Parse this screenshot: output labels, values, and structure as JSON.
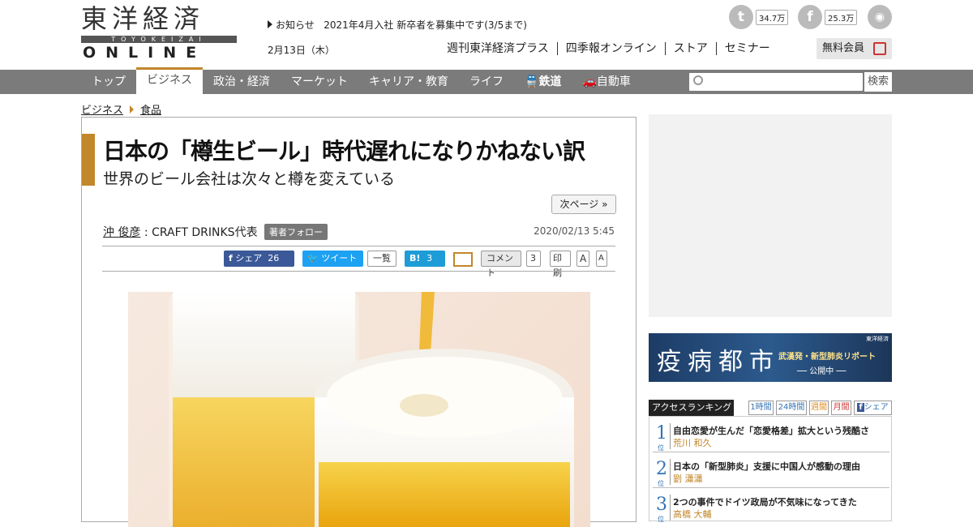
{
  "logo": {
    "kanji": "東洋経済",
    "latin": "TOYOKEIZAI",
    "online": "ONLINE"
  },
  "header": {
    "notice_label": "お知らせ",
    "notice_text": "2021年4月入社 新卒者を募集中です(3/5まで)",
    "date": "2月13日（木）",
    "links": [
      "週刊東洋経済プラス",
      "四季報オンライン",
      "ストア",
      "セミナー"
    ],
    "member_button": "無料会員",
    "twitter_count": "34.7万",
    "facebook_count": "25.3万"
  },
  "nav": {
    "items": [
      "トップ",
      "ビジネス",
      "政治・経済",
      "マーケット",
      "キャリア・教育",
      "ライフ",
      "鉄道",
      "自動車"
    ],
    "active_index": 1,
    "search_placeholder": "",
    "search_button": "検索"
  },
  "breadcrumb": [
    "ビジネス",
    "食品"
  ],
  "article": {
    "title": "日本の「樽生ビール」時代遅れになりかねない訳",
    "subtitle": "世界のビール会社は次々と樽を変えている",
    "next_page": "次ページ »",
    "author_name": "沖 俊彦",
    "author_role": " : CRAFT DRINKS代表",
    "follow_button": "著者フォロー",
    "pubdate": "2020/02/13 5:45"
  },
  "share": {
    "facebook_label": "シェア",
    "facebook_count": "26",
    "tweet_label": "ツイート",
    "list_label": "一覧",
    "hatena_label": "B!",
    "hatena_count": "3",
    "comment_label": "コメント",
    "comment_count": "3",
    "print_label": "印刷",
    "font_large": "A",
    "font_small": "A"
  },
  "banner": {
    "main": "疫病都市",
    "sub": "武漢発・新型肺炎リポート",
    "live": "── 公開中 ──",
    "tag": "東洋経済"
  },
  "ranking": {
    "title": "アクセスランキング",
    "tabs": [
      "1時間",
      "24時間",
      "週間",
      "月間",
      "シェア"
    ],
    "pos_label": "位",
    "items": [
      {
        "rank": "1",
        "title": "自由恋愛が生んだ「恋愛格差」拡大という残酷さ",
        "author": "荒川 和久"
      },
      {
        "rank": "2",
        "title": "日本の「新型肺炎」支援に中国人が感動の理由",
        "author": "劉 瀟瀟"
      },
      {
        "rank": "3",
        "title": "2つの事件でドイツ政局が不気味になってきた",
        "author": "高橋 大輔"
      }
    ]
  },
  "colors": {
    "accent": "#c2872b",
    "nav_bg": "#7b7b7b",
    "link_blue": "#3373b5"
  }
}
